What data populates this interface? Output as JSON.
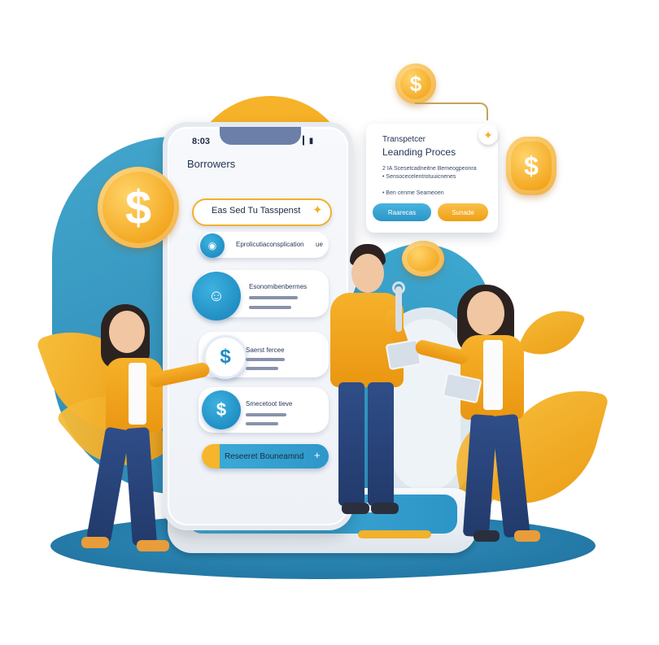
{
  "phone": {
    "status_time": "8:03",
    "status_right": "▎▮",
    "heading": "Borrowers",
    "pill_1_text": "Eas Sed Tu Tasspenst",
    "pill_2_text": "Eprolicutiaconsplication",
    "pill_2_right": "ue",
    "pill_3_line1": "Esonomibenbermes",
    "pill_4_line1": "Saerst fercee",
    "pill_5_line1": "Smecetoot tieve",
    "bottom_button": "Reseeret Bouneamnd",
    "bottom_plus": "+"
  },
  "card": {
    "title_1": "Transpetcer",
    "title_2": "Leanding Proces",
    "line_1": "2 IA Scesetcadneitne Bemeogpeonra",
    "line_2": "• Sensocecelentrotuuicnenes",
    "line_3": "• Ben cenme Seameoen",
    "btn_blue": "Raarecas",
    "btn_yellow": "Sunade"
  },
  "icons": {
    "coin_symbol": "$",
    "card_badge": "✦",
    "pill_star": "✦"
  },
  "colors": {
    "brand_blue": "#2a88b4",
    "brand_yellow": "#f3b02b"
  }
}
